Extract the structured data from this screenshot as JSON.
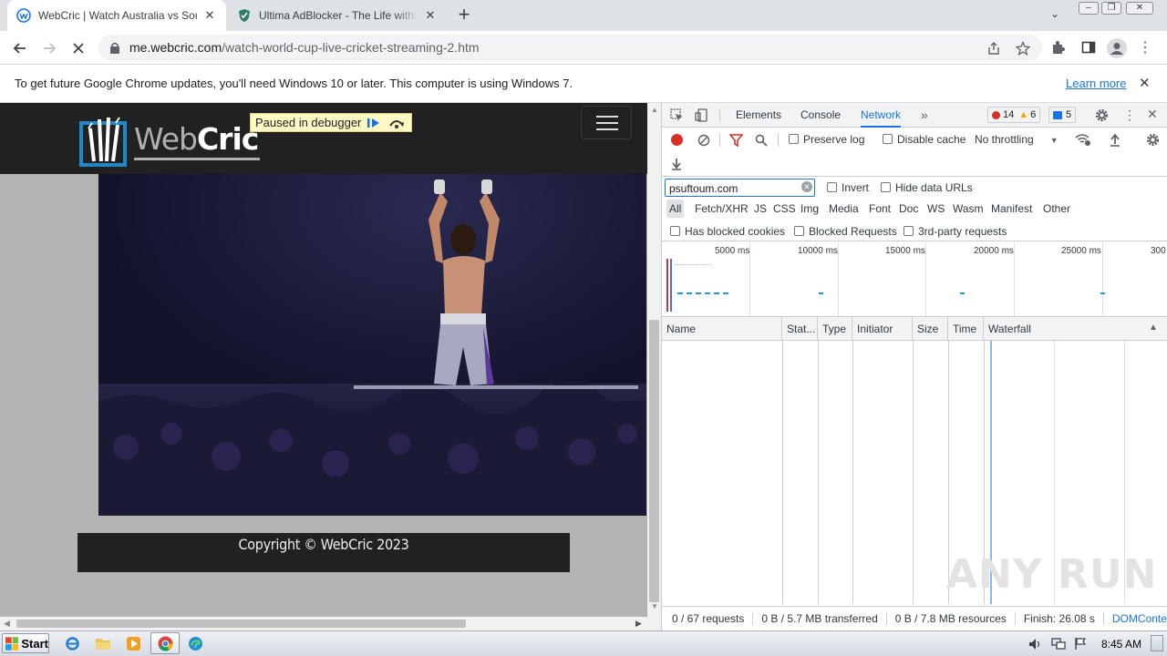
{
  "browser": {
    "tabs": [
      {
        "title": "WebCric | Watch Australia vs South",
        "active": true,
        "close": "✕"
      },
      {
        "title": "Ultima AdBlocker - The Life without A",
        "active": false,
        "close": "✕"
      }
    ],
    "new_tab": "+",
    "url_host": "me.webcric.com",
    "url_path": "/watch-world-cup-live-cricket-streaming-2.htm"
  },
  "infobar": {
    "message": "To get future Google Chrome updates, you'll need Windows 10 or later. This computer is using Windows 7.",
    "learn_more": "Learn more",
    "close": "✕"
  },
  "page": {
    "logo_web": "Web",
    "logo_cric": "Cric",
    "debugger_label": "Paused in debugger",
    "footer": "Copyright © WebCric 2023"
  },
  "devtools": {
    "tabs": [
      "Elements",
      "Console",
      "Network"
    ],
    "active_tab": "Network",
    "more": "»",
    "errors": "14",
    "warnings": "6",
    "messages": "5",
    "preserve_log": "Preserve log",
    "disable_cache": "Disable cache",
    "throttling": "No throttling",
    "filter_value": "psuftoum.com",
    "invert": "Invert",
    "hide_data_urls": "Hide data URLs",
    "filter_types": [
      "All",
      "Fetch/XHR",
      "JS",
      "CSS",
      "Img",
      "Media",
      "Font",
      "Doc",
      "WS",
      "Wasm",
      "Manifest",
      "Other"
    ],
    "has_blocked_cookies": "Has blocked cookies",
    "blocked_requests": "Blocked Requests",
    "third_party": "3rd-party requests",
    "timeline_ticks": [
      "5000 ms",
      "10000 ms",
      "15000 ms",
      "20000 ms",
      "25000 ms",
      "300"
    ],
    "columns": [
      "Name",
      "Stat...",
      "Type",
      "Initiator",
      "Size",
      "Time",
      "Waterfall"
    ],
    "status": {
      "requests": "0 / 67 requests",
      "transferred": "0 B / 5.7 MB transferred",
      "resources": "0 B / 7.8 MB resources",
      "finish": "Finish: 26.08 s",
      "domcontent": "DOMConter"
    }
  },
  "taskbar": {
    "start": "Start",
    "time": "8:45 AM"
  },
  "watermark": "ANY RUN"
}
